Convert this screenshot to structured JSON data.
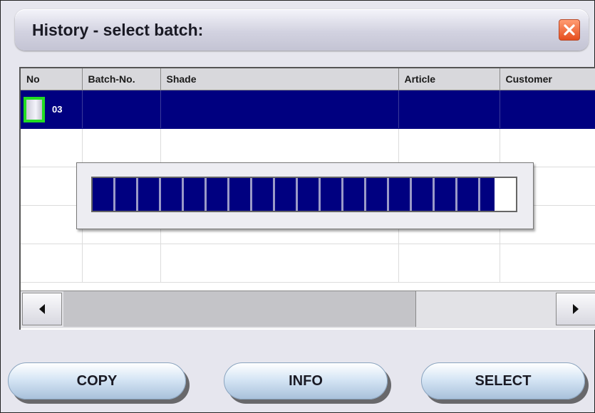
{
  "window": {
    "title": "History - select batch:"
  },
  "table": {
    "columns": [
      "No",
      "Batch-No.",
      "Shade",
      "Article",
      "Customer"
    ],
    "rows": [
      {
        "no": "03",
        "batch_no": "",
        "shade": "",
        "article": "",
        "customer": "",
        "selected": true
      }
    ],
    "empty_rows": 4
  },
  "progress": {
    "fraction": 0.95,
    "segments": 19
  },
  "scrollbar": {
    "thumb_fraction": 0.63
  },
  "buttons": {
    "copy": "COPY",
    "info": "INFO",
    "select": "SELECT"
  },
  "colors": {
    "selection": "#000080",
    "row_marker_border": "#22dd22",
    "close_button": "#e85a2a"
  },
  "icons": {
    "close": "close-icon",
    "scroll_left": "arrow-left-icon",
    "scroll_right": "arrow-right-icon",
    "row": "row-marker-icon"
  }
}
